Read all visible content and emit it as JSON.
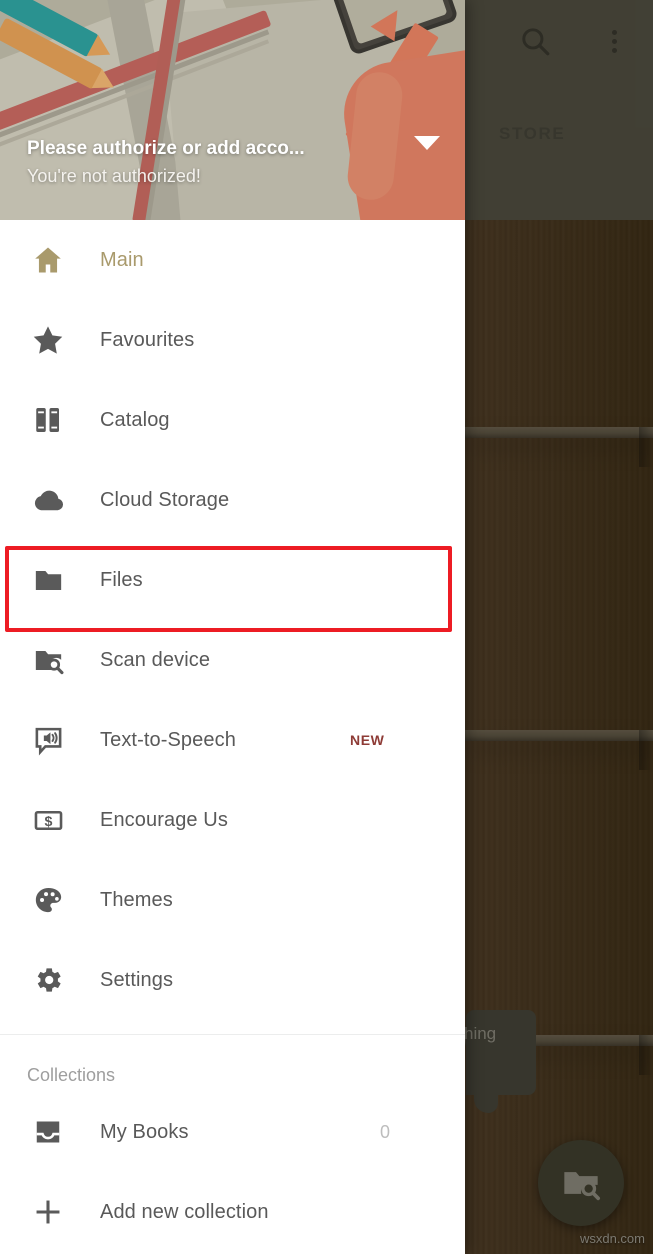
{
  "background_app": {
    "toolbar": {
      "search_icon": "search-icon",
      "overflow_icon": "overflow-menu-icon",
      "tab_label": "STORE"
    },
    "bubble_text": "hing",
    "fab_icon": "folder-search-icon",
    "watermark": "wsxdn.com"
  },
  "drawer": {
    "header": {
      "title": "Please authorize or add acco...",
      "subtitle": "You're not authorized!",
      "expand_icon": "chevron-down-icon"
    },
    "items": [
      {
        "label": "Main",
        "icon": "home-icon",
        "active": true,
        "badge": "",
        "count": ""
      },
      {
        "label": "Favourites",
        "icon": "star-icon",
        "active": false,
        "badge": "",
        "count": ""
      },
      {
        "label": "Catalog",
        "icon": "books-icon",
        "active": false,
        "badge": "",
        "count": ""
      },
      {
        "label": "Cloud Storage",
        "icon": "cloud-icon",
        "active": false,
        "badge": "",
        "count": ""
      },
      {
        "label": "Files",
        "icon": "folder-icon",
        "active": false,
        "badge": "",
        "count": ""
      },
      {
        "label": "Scan device",
        "icon": "folder-search-icon",
        "active": false,
        "badge": "",
        "count": ""
      },
      {
        "label": "Text-to-Speech",
        "icon": "speech-bubble-speaker-icon",
        "active": false,
        "badge": "NEW",
        "count": ""
      },
      {
        "label": "Encourage Us",
        "icon": "money-icon",
        "active": false,
        "badge": "",
        "count": ""
      },
      {
        "label": "Themes",
        "icon": "palette-icon",
        "active": false,
        "badge": "",
        "count": ""
      },
      {
        "label": "Settings",
        "icon": "gear-icon",
        "active": false,
        "badge": "",
        "count": ""
      }
    ],
    "collections": {
      "section_title": "Collections",
      "items": [
        {
          "label": "My Books",
          "icon": "inbox-icon",
          "count": "0"
        },
        {
          "label": "Add new collection",
          "icon": "plus-icon",
          "count": ""
        }
      ]
    },
    "highlight": {
      "target_label": "Files",
      "color": "#ed1c24"
    }
  },
  "colors": {
    "accent_gold": "#a99a6c",
    "icon_gray": "#5a5a5a",
    "text_gray": "#595959",
    "badge_red": "#8e3b36",
    "highlight_red": "#ed1c24"
  }
}
